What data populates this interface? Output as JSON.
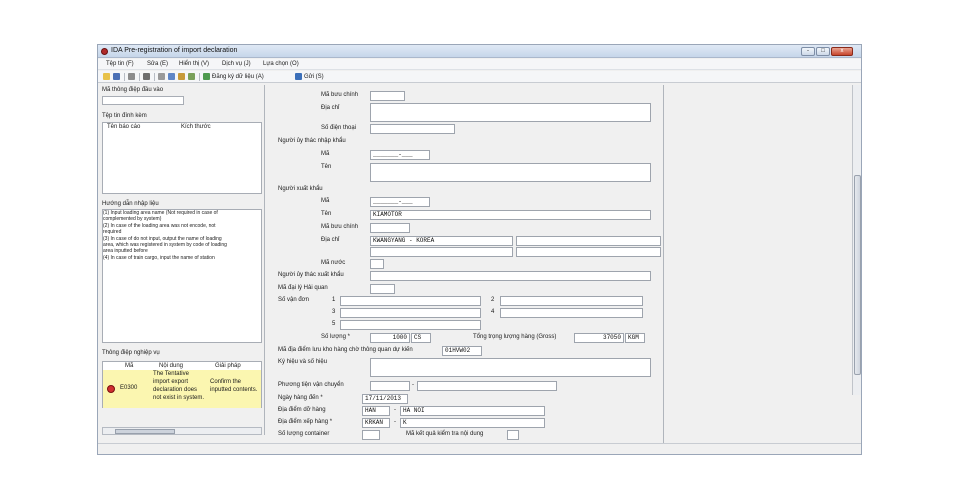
{
  "window": {
    "title": "IDA Pre-registration of import declaration",
    "buttons": [
      "-",
      "□",
      "x"
    ]
  },
  "menu": [
    "Tệp tin (F)",
    "Sửa (E)",
    "Hiển thị (V)",
    "Dịch vụ (J)",
    "Lựa chọn (O)"
  ],
  "toolbar": {
    "register_label": "Đăng ký dữ liệu (A)",
    "send_label": "Gửi (S)"
  },
  "left_panel": {
    "input_msg_label": "Mã thông điệp đầu vào",
    "attachments_label": "Tệp tin đính kèm",
    "attachments_cols": [
      "Tên báo cáo",
      "Kích thước"
    ],
    "guide_title": "Hướng dẫn nhập liệu",
    "guide_lines": [
      "(1) Input loading area name (Not required in case of",
      "complemented by system)",
      "(2) In case of the loading area was not encode, not",
      "required",
      "(3) In case of do not input, output the name of loading",
      "area, which was registered in system by code of loading",
      "area inputted before",
      "(4) In case of train cargo, input the name of station"
    ],
    "business_msg_label": "Thông điệp nghiệp vụ",
    "msg_cols": [
      "Mã",
      "Nội dung",
      "Giải pháp"
    ],
    "msg_row": {
      "code": "E0300",
      "content": [
        "The Tentative",
        "import export",
        "declaration does",
        "not exist in system."
      ],
      "solution": [
        "Confirm the",
        "inputted contents."
      ]
    }
  },
  "form": {
    "postal_label": "Mã bưu chính",
    "address_label": "Địa chỉ",
    "phone_label": "Số điện thoại",
    "importer_trustee_label": "Người ủy thác nhập khẩu",
    "code_label": "Mã",
    "name_label": "Tên",
    "exporter_label": "Người xuất khẩu",
    "exporter_name": "KIAMOTOR",
    "exporter_address": "KWANGYANG - KOREA",
    "country_label": "Mã nước",
    "exporter_trustee_label": "Người ủy thác xuất khẩu",
    "customs_agent_label": "Mã đại lý Hải quan",
    "bill_label": "Số vận đơn",
    "bill_nums": [
      "1",
      "2",
      "3",
      "4",
      "5"
    ],
    "quantity_label": "Số lượng *",
    "quantity_value": "1000",
    "quantity_unit": "CS",
    "gross_label": "Tổng trọng lượng hàng (Gross)",
    "gross_value": "37050",
    "gross_unit": "KGM",
    "warehouse_label": "Mã địa điểm lưu kho hàng chờ thông quan dự kiến",
    "warehouse_value": "01HVW02",
    "marks_label": "Ký hiệu và số hiệu",
    "transport_label": "Phương tiện vận chuyển",
    "arrival_label": "Ngày hàng đến *",
    "arrival_value": "17/11/2013",
    "unload_label": "Địa điểm dỡ hàng",
    "unload_code": "HAN",
    "unload_name": "HA NOI",
    "load_label": "Địa điểm xếp hàng *",
    "load_code": "KRKAN",
    "load_name": "K",
    "container_label": "Số lượng container",
    "check_result_label": "Mã kết quả kiểm tra nội dung",
    "code_mask": "_______-___",
    "dash": "-"
  }
}
